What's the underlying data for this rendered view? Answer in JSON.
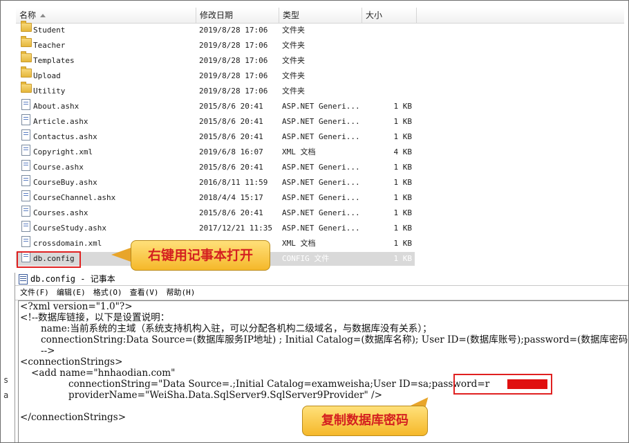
{
  "explorer": {
    "columns": {
      "name": "名称",
      "date": "修改日期",
      "type": "类型",
      "size": "大小"
    },
    "rows": [
      {
        "icon": "folder-icon",
        "name": "Student",
        "date": "2019/8/28 17:06",
        "type": "文件夹",
        "size": ""
      },
      {
        "icon": "folder-icon",
        "name": "Teacher",
        "date": "2019/8/28 17:06",
        "type": "文件夹",
        "size": ""
      },
      {
        "icon": "folder-icon",
        "name": "Templates",
        "date": "2019/8/28 17:06",
        "type": "文件夹",
        "size": ""
      },
      {
        "icon": "folder-icon",
        "name": "Upload",
        "date": "2019/8/28 17:06",
        "type": "文件夹",
        "size": ""
      },
      {
        "icon": "folder-icon",
        "name": "Utility",
        "date": "2019/8/28 17:06",
        "type": "文件夹",
        "size": ""
      },
      {
        "icon": "file-icon",
        "name": "About.ashx",
        "date": "2015/8/6 20:41",
        "type": "ASP.NET Generi...",
        "size": "1 KB"
      },
      {
        "icon": "file-icon",
        "name": "Article.ashx",
        "date": "2015/8/6 20:41",
        "type": "ASP.NET Generi...",
        "size": "1 KB"
      },
      {
        "icon": "file-icon",
        "name": "Contactus.ashx",
        "date": "2015/8/6 20:41",
        "type": "ASP.NET Generi...",
        "size": "1 KB"
      },
      {
        "icon": "file-icon",
        "name": "Copyright.xml",
        "date": "2019/6/8 16:07",
        "type": "XML 文档",
        "size": "4 KB"
      },
      {
        "icon": "file-icon",
        "name": "Course.ashx",
        "date": "2015/8/6 20:41",
        "type": "ASP.NET Generi...",
        "size": "1 KB"
      },
      {
        "icon": "file-icon",
        "name": "CourseBuy.ashx",
        "date": "2016/8/11 11:59",
        "type": "ASP.NET Generi...",
        "size": "1 KB"
      },
      {
        "icon": "file-icon",
        "name": "CourseChannel.ashx",
        "date": "2018/4/4 15:17",
        "type": "ASP.NET Generi...",
        "size": "1 KB"
      },
      {
        "icon": "file-icon",
        "name": "Courses.ashx",
        "date": "2015/8/6 20:41",
        "type": "ASP.NET Generi...",
        "size": "1 KB"
      },
      {
        "icon": "file-icon",
        "name": "CourseStudy.ashx",
        "date": "2017/12/21 11:35",
        "type": "ASP.NET Generi...",
        "size": "1 KB"
      },
      {
        "icon": "file-icon",
        "name": "crossdomain.xml",
        "date": "",
        "type": "XML 文档",
        "size": "1 KB"
      },
      {
        "icon": "file-icon",
        "name": "db.config",
        "date": "",
        "type": "CONFIG 文件",
        "size": "1 KB",
        "selected": true
      }
    ]
  },
  "callouts": {
    "open_with_notepad": "右键用记事本打开",
    "copy_password": "复制数据库密码"
  },
  "notepad": {
    "title": "db.config - 记事本",
    "menu": [
      "文件(F)",
      "编辑(E)",
      "格式(O)",
      "查看(V)",
      "帮助(H)"
    ],
    "lines": [
      "<?xml version=\"1.0\"?>",
      "<!--数据库链接，以下是设置说明：",
      "name:当前系统的主域（系统支持机构入驻，可以分配各机构二级域名，与数据库没有关系）；",
      "connectionString:Data Source=(数据库服务IP地址) ; Initial Catalog=(数据库名称); User ID=(数据库账号);password=(数据库密码)",
      "-->",
      "<connectionStrings>",
      "<add name=\"hnhaodian.com\"",
      "connectionString=\"Data Source=.;Initial Catalog=examweisha;User ID=sa;password=r          \"",
      "providerName=\"WeiSha.Data.SqlServer9.SqlServer9Provider\" />",
      "",
      "</connectionStrings>"
    ]
  },
  "left_stub": {
    "a": "s",
    "b": "a"
  }
}
